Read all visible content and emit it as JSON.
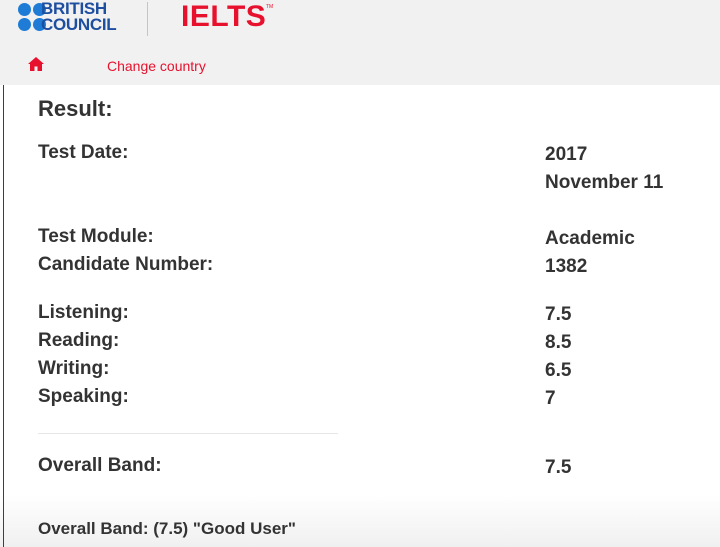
{
  "header": {
    "brand_line1": "BRITISH",
    "brand_line2": "COUNCIL",
    "ielts": "IELTS",
    "trademark": "TM",
    "change_country": "Change country",
    "colors": {
      "brand_blue": "#1e7bd6",
      "brand_red": "#e8112d",
      "header_bg": "#f1f1f1"
    }
  },
  "result": {
    "title": "Result:",
    "test_date_label": "Test Date:",
    "test_date_value": "2017 November 11",
    "test_module_label": "Test Module:",
    "test_module_value": "Academic",
    "candidate_label": "Candidate Number:",
    "candidate_value": "1382",
    "listening_label": "Listening:",
    "listening_value": "7.5",
    "reading_label": "Reading:",
    "reading_value": "8.5",
    "writing_label": "Writing:",
    "writing_value": "6.5",
    "speaking_label": "Speaking:",
    "speaking_value": "7",
    "overall_label": "Overall Band:",
    "overall_value": "7.5",
    "overall_note": "Overall Band: (7.5) \"Good User\""
  }
}
